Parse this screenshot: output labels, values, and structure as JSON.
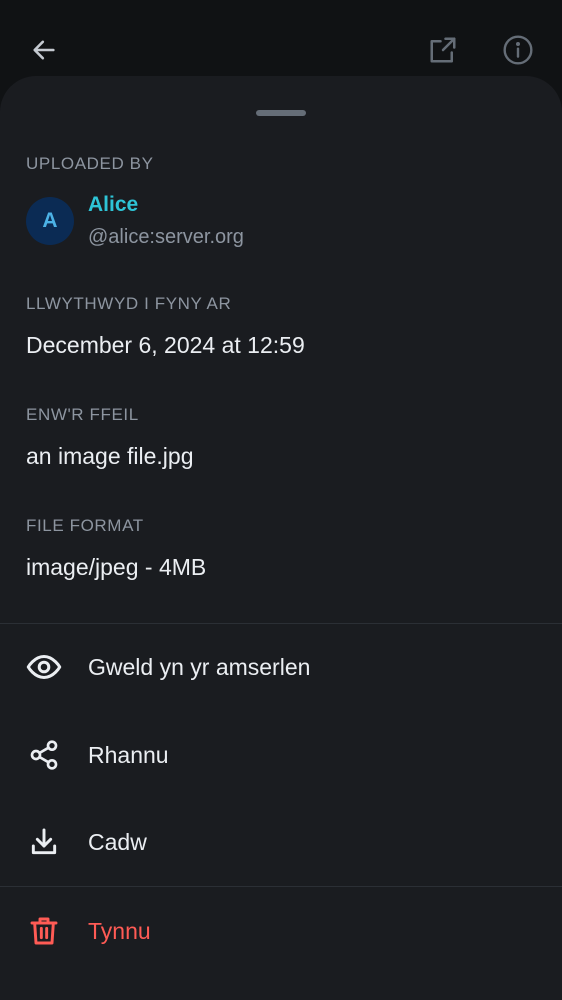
{
  "topbar": {
    "back_icon": "arrow-left-icon",
    "open_external_icon": "open-external-icon",
    "info_icon": "info-icon"
  },
  "uploader": {
    "label": "UPLOADED BY",
    "avatar_initial": "A",
    "name": "Alice",
    "id": "@alice:server.org"
  },
  "uploaded_on": {
    "label": "LLWYTHWYD I FYNY AR",
    "value": "December 6, 2024 at 12:59"
  },
  "file_name": {
    "label": "ENW'R FFEIL",
    "value": "an image file.jpg"
  },
  "file_format": {
    "label": "FILE FORMAT",
    "value": "image/jpeg - 4MB"
  },
  "actions": [
    {
      "label": "Gweld yn yr amserlen",
      "icon": "eye-icon"
    },
    {
      "label": "Rhannu",
      "icon": "share-icon"
    },
    {
      "label": "Cadw",
      "icon": "download-icon"
    }
  ],
  "danger_action": {
    "label": "Tynnu",
    "icon": "trash-icon"
  },
  "colors": {
    "background": "#101214",
    "sheet": "#1a1c20",
    "accent_name": "#2ec4d6",
    "danger": "#ff5b55",
    "secondary_text": "#8d95a0"
  }
}
